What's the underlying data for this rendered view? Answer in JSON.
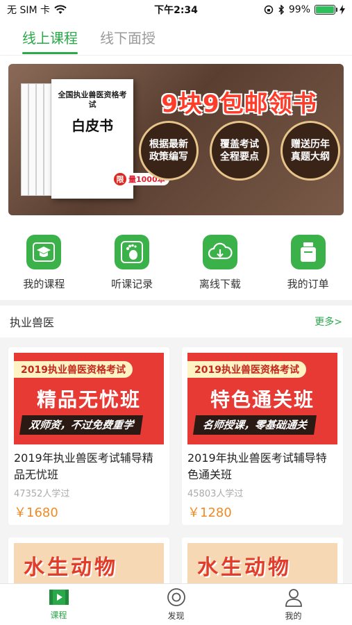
{
  "status_bar": {
    "carrier": "无 SIM 卡",
    "time": "下午2:34",
    "battery": "99%",
    "battery_level": 0.99
  },
  "top_tabs": [
    {
      "label": "线上课程",
      "active": true
    },
    {
      "label": "线下面授",
      "active": false
    }
  ],
  "banner": {
    "headline": "9块9包邮领书",
    "book_title": "全国执业兽医资格考试",
    "book_name": "白皮书",
    "limit_char": "限",
    "limit_text": "量1000本",
    "features": [
      "根据最新政策编写",
      "覆盖考试全程要点",
      "赠送历年真题大纲"
    ]
  },
  "quick_actions": [
    {
      "label": "我的课程",
      "icon": "graduation-cap-icon"
    },
    {
      "label": "听课记录",
      "icon": "footprint-icon"
    },
    {
      "label": "离线下载",
      "icon": "cloud-download-icon"
    },
    {
      "label": "我的订单",
      "icon": "order-jar-icon"
    }
  ],
  "section": {
    "title": "执业兽医",
    "more": "更多>"
  },
  "courses": [
    {
      "thumb_top": "2019执业兽医资格考试",
      "thumb_main": "精品无忧班",
      "thumb_ribbon": "双师资，不过免费重学",
      "title": "2019年执业兽医考试辅导精品无忧班",
      "count": "47352人学过",
      "price": "￥1680"
    },
    {
      "thumb_top": "2019执业兽医资格考试",
      "thumb_main": "特色通关班",
      "thumb_ribbon": "名师授课，零基础通关",
      "title": "2019年执业兽医考试辅导特色通关班",
      "count": "45803人学过",
      "price": "￥1280"
    },
    {
      "thumb_main": "水生动物"
    },
    {
      "thumb_main": "水生动物"
    }
  ],
  "bottom_nav": [
    {
      "label": "课程",
      "icon": "play-screen-icon",
      "active": true
    },
    {
      "label": "发现",
      "icon": "target-icon",
      "active": false
    },
    {
      "label": "我的",
      "icon": "user-icon",
      "active": false
    }
  ],
  "colors": {
    "accent": "#2aa84a",
    "price": "#f08a24",
    "icon_bg": "#3bb14a"
  }
}
